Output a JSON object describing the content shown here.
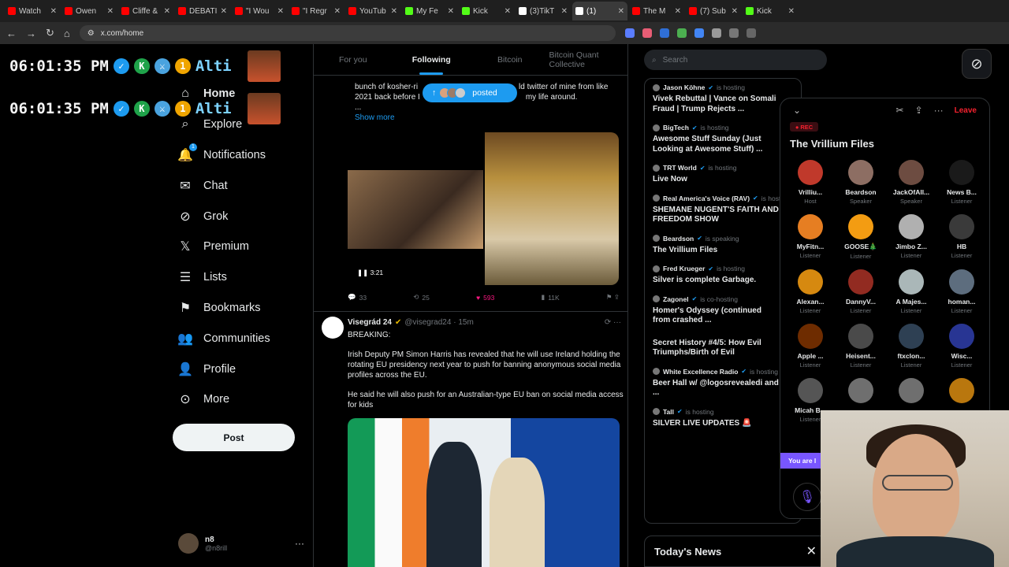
{
  "browser": {
    "tabs": [
      {
        "label": "Watch",
        "color": "#ff0000",
        "active": false
      },
      {
        "label": "Owen",
        "color": "#ff0000",
        "active": false
      },
      {
        "label": "Cliffe &",
        "color": "#ff0000",
        "active": false
      },
      {
        "label": "DEBATI",
        "color": "#ff0000",
        "active": false
      },
      {
        "label": "\"I Wou",
        "color": "#ff0000",
        "active": false
      },
      {
        "label": "\"I Regr",
        "color": "#ff0000",
        "active": false
      },
      {
        "label": "YouTub",
        "color": "#ff0000",
        "active": false
      },
      {
        "label": "My Fe",
        "color": "#53fc18",
        "active": false
      },
      {
        "label": "Kick",
        "color": "#53fc18",
        "active": false
      },
      {
        "label": "(3)TikT",
        "color": "#ffffff",
        "active": false
      },
      {
        "label": "(1)",
        "color": "#ffffff",
        "active": true
      },
      {
        "label": "The M",
        "color": "#ff0000",
        "active": false
      },
      {
        "label": "(7) Sub",
        "color": "#ff0000",
        "active": false
      },
      {
        "label": "Kick",
        "color": "#53fc18",
        "active": false
      }
    ],
    "url": "x.com/home"
  },
  "overlay": {
    "time": "06:01:35 PM",
    "name": "Alti"
  },
  "sidebar": {
    "items": [
      {
        "label": "Home",
        "icon": "home-icon",
        "glyph": "⌂"
      },
      {
        "label": "Explore",
        "icon": "search-icon",
        "glyph": "⌕"
      },
      {
        "label": "Notifications",
        "icon": "bell-icon",
        "glyph": "🔔"
      },
      {
        "label": "Chat",
        "icon": "mail-icon",
        "glyph": "✉"
      },
      {
        "label": "Grok",
        "icon": "grok-icon",
        "glyph": "⊘"
      },
      {
        "label": "Premium",
        "icon": "x-logo-icon",
        "glyph": "𝕏"
      },
      {
        "label": "Lists",
        "icon": "list-icon",
        "glyph": "☰"
      },
      {
        "label": "Bookmarks",
        "icon": "bookmark-icon",
        "glyph": "⚑"
      },
      {
        "label": "Communities",
        "icon": "people-icon",
        "glyph": "👥"
      },
      {
        "label": "Profile",
        "icon": "person-icon",
        "glyph": "👤"
      },
      {
        "label": "More",
        "icon": "more-circle-icon",
        "glyph": "⊙"
      }
    ],
    "notif_count": "1",
    "post_label": "Post",
    "account": {
      "name": "n8",
      "handle": "@n8rill",
      "more": "···"
    }
  },
  "feed": {
    "tabs": [
      "For you",
      "Following",
      "Bitcoin",
      "Bitcoin Quant Collective"
    ],
    "tweet1": {
      "line1": "bunch of kosher-ri",
      "line1b": "ld twitter of mine from like",
      "line2": "2021 back before I",
      "line2b": "my life around.",
      "ellipsis": "...",
      "show_more": "Show more",
      "video_time": "3:21",
      "replies": "33",
      "reposts": "25",
      "likes": "593",
      "views": "11K"
    },
    "posted_pill": "posted",
    "tweet2": {
      "name": "Visegrád 24",
      "handle": "@visegrad24 · 15m",
      "p1": "BREAKING:",
      "p2": "Irish Deputy PM Simon Harris has revealed that he will use Ireland holding the rotating EU presidency next year to push for banning anonymous social media profiles across the EU.",
      "p3": "He said he will also push for an Australian-type EU ban on social media access for kids"
    }
  },
  "right": {
    "search_placeholder": "Search",
    "spaces": [
      {
        "host": "Jason Köhne",
        "status": "is hosting",
        "title": "Vivek Rebuttal | Vance on Somali Fraud | Trump Rejects ..."
      },
      {
        "host": "BigTech",
        "status": "is hosting",
        "title": "Awesome Stuff Sunday (Just Looking at Awesome Stuff) ..."
      },
      {
        "host": "TRT World",
        "status": "is hosting",
        "title": "Live Now"
      },
      {
        "host": "Real America's Voice (RAV)",
        "status": "is hosting",
        "title": "SHEMANE NUGENT'S FAITH AND FREEDOM SHOW"
      },
      {
        "host": "Beardson",
        "status": "is speaking",
        "title": "The Vrillium Files"
      },
      {
        "host": "Fred Krueger",
        "status": "is hosting",
        "title": "Silver is complete Garbage."
      },
      {
        "host": "Zagonel",
        "status": "is co-hosting",
        "title": "Homer's Odyssey (continued from crashed ..."
      },
      {
        "host": "",
        "status": "",
        "title": "Secret History #4/5: How Evil Triumphs/Birth of Evil"
      },
      {
        "host": "White Excellence Radio",
        "status": "is hosting",
        "title": "Beer Hall w/ @logosrevealedi and ..."
      },
      {
        "host": "Tall",
        "status": "is hosting",
        "title": "SILVER LIVE UPDATES 🚨"
      }
    ],
    "news_title": "Today's News",
    "news_close": "✕"
  },
  "space_panel": {
    "rec": "REC",
    "title": "The Vrillium Files",
    "leave": "Leave",
    "you_are": "You are l",
    "participants": [
      {
        "name": "Vrilliu...",
        "role": "Host",
        "color": "#c0392b"
      },
      {
        "name": "Beardson",
        "role": "Speaker",
        "color": "#8d6e63"
      },
      {
        "name": "JackOfAll...",
        "role": "Speaker",
        "color": "#6d4c41"
      },
      {
        "name": "News B...",
        "role": "Listener",
        "color": "#1a1a1a"
      },
      {
        "name": "MyFitn...",
        "role": "Listener",
        "color": "#e67e22"
      },
      {
        "name": "GOOSE🎄",
        "role": "Listener",
        "color": "#f39c12"
      },
      {
        "name": "Jimbo Z...",
        "role": "Listener",
        "color": "#b0b0b0"
      },
      {
        "name": "HB",
        "role": "Listener",
        "color": "#3a3a3a"
      },
      {
        "name": "Alexan...",
        "role": "Listener",
        "color": "#d68910"
      },
      {
        "name": "DannyV...",
        "role": "Listener",
        "color": "#922b21"
      },
      {
        "name": "A Majes...",
        "role": "Listener",
        "color": "#aab7b8"
      },
      {
        "name": "homan...",
        "role": "Listener",
        "color": "#5d6d7e"
      },
      {
        "name": "Apple ...",
        "role": "Listener",
        "color": "#6e2c00"
      },
      {
        "name": "Heisent...",
        "role": "Listener",
        "color": "#4a4a4a"
      },
      {
        "name": "ftxclon...",
        "role": "Listener",
        "color": "#2e4053"
      },
      {
        "name": "Wisc...",
        "role": "Listener",
        "color": "#283593"
      },
      {
        "name": "Micah B...",
        "role": "Listener",
        "color": "#555555"
      },
      {
        "name": "",
        "role": "",
        "color": "#6f6f6f"
      },
      {
        "name": "",
        "role": "",
        "color": "#6f6f6f"
      },
      {
        "name": "",
        "role": "",
        "color": "#b9770e"
      }
    ]
  }
}
